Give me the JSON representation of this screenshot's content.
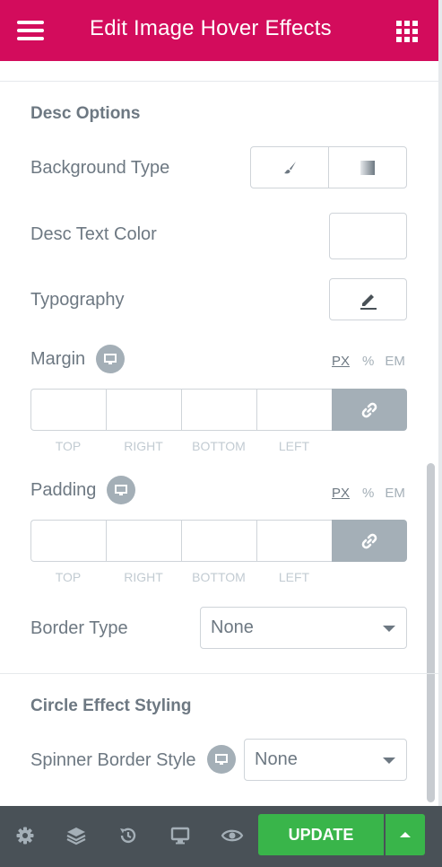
{
  "header": {
    "title": "Edit Image Hover Effects",
    "menu_icon": "hamburger-icon",
    "apps_icon": "grid-icon"
  },
  "desc_options": {
    "title": "Desc Options",
    "background_type": {
      "label": "Background Type",
      "options": [
        "brush-icon",
        "gradient-icon"
      ]
    },
    "text_color": {
      "label": "Desc Text Color"
    },
    "typography": {
      "label": "Typography",
      "icon": "pencil-icon"
    },
    "margin": {
      "label": "Margin",
      "units": [
        "PX",
        "%",
        "EM"
      ],
      "active_unit": "PX",
      "fields": [
        "TOP",
        "RIGHT",
        "BOTTOM",
        "LEFT"
      ],
      "values": [
        "",
        "",
        "",
        ""
      ]
    },
    "padding": {
      "label": "Padding",
      "units": [
        "PX",
        "%",
        "EM"
      ],
      "active_unit": "PX",
      "fields": [
        "TOP",
        "RIGHT",
        "BOTTOM",
        "LEFT"
      ],
      "values": [
        "",
        "",
        "",
        ""
      ]
    },
    "border_type": {
      "label": "Border Type",
      "value": "None"
    }
  },
  "circle_effect": {
    "title": "Circle Effect Styling",
    "spinner_border_style": {
      "label": "Spinner Border Style",
      "value": "None"
    }
  },
  "footer": {
    "icons": [
      "settings-icon",
      "layers-icon",
      "history-icon",
      "responsive-icon",
      "preview-icon"
    ],
    "update_label": "UPDATE"
  },
  "colors": {
    "brand": "#d30c5c",
    "update": "#39b54a",
    "footer_bg": "#495157",
    "text": "#6d7882"
  }
}
